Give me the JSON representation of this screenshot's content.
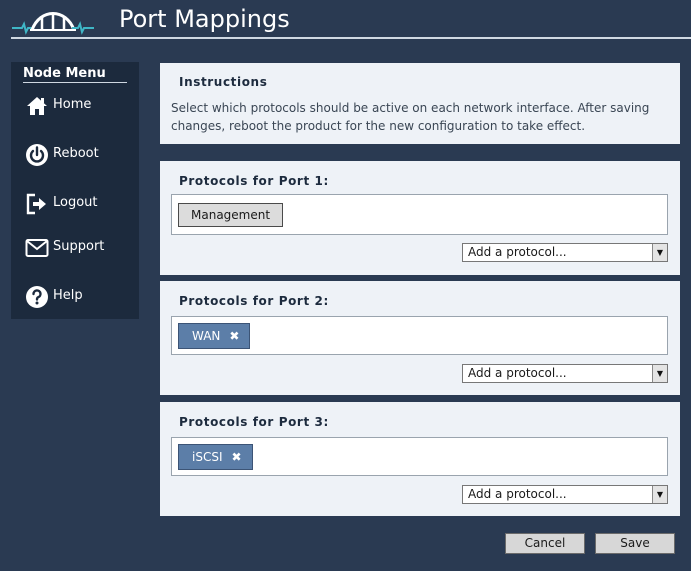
{
  "header": {
    "title": "Port Mappings",
    "logo_icon": "bridge-logo-icon"
  },
  "sidebar": {
    "title": "Node Menu",
    "items": [
      {
        "label": "Home",
        "icon": "home-icon"
      },
      {
        "label": "Reboot",
        "icon": "power-icon"
      },
      {
        "label": "Logout",
        "icon": "logout-icon"
      },
      {
        "label": "Support",
        "icon": "envelope-icon"
      },
      {
        "label": "Help",
        "icon": "help-icon"
      }
    ]
  },
  "instructions": {
    "title": "Instructions",
    "text": "Select which protocols should be active on each network interface. After saving changes, reboot the product for the new configuration to take effect."
  },
  "ports": [
    {
      "title": "Protocols for Port 1:",
      "tags": [
        {
          "label": "Management",
          "removable": false
        }
      ],
      "add_placeholder": "Add a protocol..."
    },
    {
      "title": "Protocols for Port 2:",
      "tags": [
        {
          "label": "WAN",
          "removable": true
        }
      ],
      "add_placeholder": "Add a protocol..."
    },
    {
      "title": "Protocols for Port 3:",
      "tags": [
        {
          "label": "iSCSI",
          "removable": true
        }
      ],
      "add_placeholder": "Add a protocol..."
    }
  ],
  "tag_remove_glyph": "✖",
  "select_arrow_glyph": "▼",
  "actions": {
    "cancel_label": "Cancel",
    "save_label": "Save"
  },
  "colors": {
    "background": "#2a3a52",
    "sidebar": "#1c2a3d",
    "panel": "#eef2f7",
    "tag_chip": "#5c7ea8",
    "logo_accent": "#3fb6c6"
  }
}
